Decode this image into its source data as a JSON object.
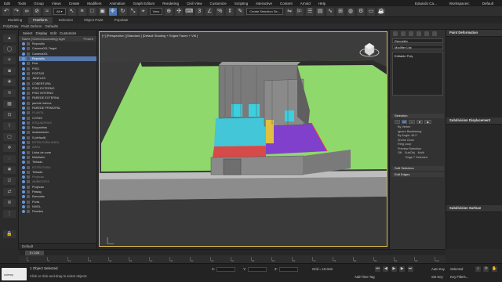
{
  "menubar": {
    "items": [
      "Edit",
      "Tools",
      "Group",
      "Views",
      "Create",
      "Modifiers",
      "Animation",
      "Graph Editors",
      "Rendering",
      "Civil View",
      "Customize",
      "Scripting",
      "Interactive",
      "Content",
      "Arnold",
      "Help"
    ],
    "user": "Eduardo Ca...",
    "workspaces_label": "Workspaces:",
    "workspace_value": "Default"
  },
  "toolbar": {
    "view_dropdown": "View",
    "selection_set": "Create Selection Se..."
  },
  "ribbon": {
    "tabs": [
      "Modeling",
      "Freeform",
      "Selection",
      "Object Paint",
      "Populate"
    ],
    "active_tab": "Freeform",
    "sub_items": [
      "PolyDraw",
      "Paint Deform",
      "Defaults"
    ]
  },
  "explorer": {
    "tabs": [
      "Select",
      "Display",
      "Edit",
      "Customize"
    ],
    "header_name": "Name (Sorted Ascending) Agei",
    "header_frozen": "Frozen",
    "rows": [
      {
        "label": "Repositio",
        "state": "normal"
      },
      {
        "label": "Camera001.Target",
        "state": "normal"
      },
      {
        "label": "Camera001",
        "state": "normal"
      },
      {
        "label": "Repositio",
        "state": "selected"
      },
      {
        "label": "Rua",
        "state": "normal"
      },
      {
        "label": "PISO",
        "state": "normal"
      },
      {
        "label": "PORTAS",
        "state": "normal"
      },
      {
        "label": "JANELAS",
        "state": "normal"
      },
      {
        "label": "COBERTURA",
        "state": "normal"
      },
      {
        "label": "PISO EXTERNO",
        "state": "normal"
      },
      {
        "label": "PISO INTERNO",
        "state": "normal"
      },
      {
        "label": "PAREDE EXTERNA",
        "state": "normal"
      },
      {
        "label": "parede interna",
        "state": "normal"
      },
      {
        "label": "PAREDE PRINCIPAL",
        "state": "normal"
      },
      {
        "label": "PLANTA",
        "state": "dim"
      },
      {
        "label": "COTAS",
        "state": "normal"
      },
      {
        "label": "ESQUADRIAS",
        "state": "dim"
      },
      {
        "label": "Esquadrias",
        "state": "normal"
      },
      {
        "label": "Acabamento",
        "state": "normal"
      },
      {
        "label": "0 (default)",
        "state": "normal"
      },
      {
        "label": "ESTRUTURA AREA",
        "state": "dim"
      },
      {
        "label": "AREA",
        "state": "dim"
      },
      {
        "label": "Linha de corte",
        "state": "normal"
      },
      {
        "label": "Mobiliario",
        "state": "normal"
      },
      {
        "label": "Telhado",
        "state": "normal"
      },
      {
        "label": "ESTRUTURA",
        "state": "dim"
      },
      {
        "label": "Telhado",
        "state": "normal"
      },
      {
        "label": "Projecao",
        "state": "dim"
      },
      {
        "label": "AMBIENTES",
        "state": "dim"
      },
      {
        "label": "Projecao",
        "state": "normal"
      },
      {
        "label": "Paisag",
        "state": "normal"
      },
      {
        "label": "Esmoobs",
        "state": "normal"
      },
      {
        "label": "Porta",
        "state": "normal"
      },
      {
        "label": "NIVEL",
        "state": "normal"
      },
      {
        "label": "Paredes",
        "state": "normal"
      }
    ],
    "footer": "Default"
  },
  "viewport": {
    "label": "[+] [Perspective ] [Standard ] [Default Shading + Edged Faces + VM ]"
  },
  "command_panel": {
    "object_name": "Repositio",
    "modifier_list": "Modifier List",
    "stack_item": "Editable Poly",
    "selection_header": "Selection",
    "options": [
      "By Vertex",
      "Ignore Backfacing",
      "By Angle: 45.0",
      "Shrink   Grow",
      "Ring   Loop"
    ],
    "preview_label": "Preview Selection",
    "preview_opts": [
      "Off",
      "SubObj",
      "Multi"
    ],
    "selected_count": "Edge 7 Selected",
    "soft_selection": "Soft Selection",
    "edit_edges": "Edit Edges"
  },
  "right_panel": {
    "paint_deformation": "Paint Deformation",
    "subdivision_displacement": "Subdivision Displacement",
    "subdivision_surface": "Subdivision Surface"
  },
  "timeline": {
    "knob": "0 / 100",
    "ticks": [
      "0",
      "5",
      "10",
      "15",
      "20",
      "25",
      "30",
      "35",
      "40",
      "45",
      "50",
      "55",
      "60",
      "65",
      "70",
      "75",
      "80",
      "85",
      "90",
      "95",
      "100"
    ]
  },
  "status": {
    "line1": "1 Object Selected",
    "line2": "Click or click-and-drag to select objects",
    "x_label": "X:",
    "y_label": "Y:",
    "z_label": "Z:",
    "grid": "Grid = 10.0cm",
    "add_time_tag": "Add Time Tag",
    "auto_key": "Auto Key",
    "set_key": "Set Key",
    "selected": "Selected",
    "key_filters": "Key Filters..."
  },
  "brand": {
    "logo_text": "udemy"
  },
  "colors": {
    "accent": "#4a78b5",
    "viewport_border": "#d9b84a",
    "grass": "#8ed86c",
    "cyan_floor": "#42c6d8",
    "purple_floor": "#8140cc",
    "red_floor": "#d64a4a"
  }
}
